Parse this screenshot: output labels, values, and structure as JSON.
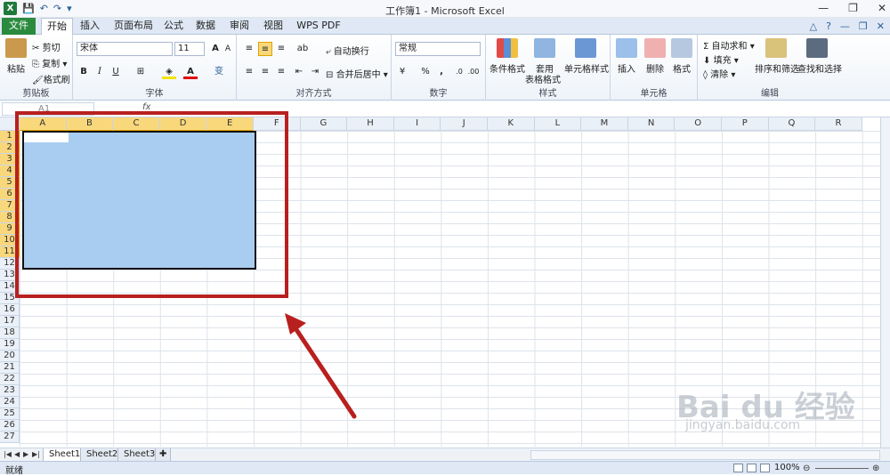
{
  "window": {
    "title": "工作簿1 - Microsoft Excel",
    "minimize": "—",
    "restore": "❐",
    "close": "✕"
  },
  "qat": {
    "save": "💾",
    "undo": "↶",
    "redo": "↷",
    "more": "▾"
  },
  "tabs": [
    "文件",
    "开始",
    "插入",
    "页面布局",
    "公式",
    "数据",
    "审阅",
    "视图",
    "WPS PDF"
  ],
  "ribbon": {
    "clipboard": {
      "label": "剪贴板",
      "paste": "粘贴",
      "cut": "剪切",
      "copy": "复制",
      "format_painter": "格式刷"
    },
    "font": {
      "label": "字体",
      "font_name": "宋体",
      "font_size": "11",
      "bold": "B",
      "italic": "I",
      "underline": "U",
      "grow": "A",
      "shrink": "A",
      "wen": "变"
    },
    "alignment": {
      "label": "对齐方式",
      "wrap": "自动换行",
      "merge": "合并后居中"
    },
    "number": {
      "label": "数字",
      "format": "常规",
      "percent": "%",
      "comma": ","
    },
    "styles": {
      "label": "样式",
      "conditional": "条件格式",
      "table_line1": "套用",
      "table_line2": "表格格式",
      "cell_styles": "单元格样式"
    },
    "cells": {
      "label": "单元格",
      "insert": "插入",
      "delete": "删除",
      "format": "格式"
    },
    "editing": {
      "label": "编辑",
      "autosum": "自动求和",
      "fill": "填充",
      "clear": "清除",
      "sort": "排序和筛选",
      "find": "查找和选择"
    }
  },
  "formula": {
    "name_box": "A1",
    "fx": "fx"
  },
  "columns": [
    "A",
    "B",
    "C",
    "D",
    "E",
    "F",
    "G",
    "H",
    "I",
    "J",
    "K",
    "L",
    "M",
    "N",
    "O",
    "P",
    "Q",
    "R"
  ],
  "rows": [
    "1",
    "2",
    "3",
    "4",
    "5",
    "6",
    "7",
    "8",
    "9",
    "10",
    "11",
    "12",
    "13",
    "14",
    "15",
    "16",
    "17",
    "18",
    "19",
    "20",
    "21",
    "22",
    "23",
    "24",
    "25",
    "26",
    "27"
  ],
  "sheets": [
    "Sheet1",
    "Sheet2",
    "Sheet3"
  ],
  "status": {
    "ready": "就绪",
    "zoom": "100%",
    "minus": "⊖",
    "plus": "⊕"
  },
  "watermark": {
    "logo": "Bai du 经验",
    "url": "jingyan.baidu.com"
  },
  "colors": {
    "selection": "#a9cdf0",
    "highlight_box": "#b8201f",
    "file_tab": "#2a8a3e"
  }
}
